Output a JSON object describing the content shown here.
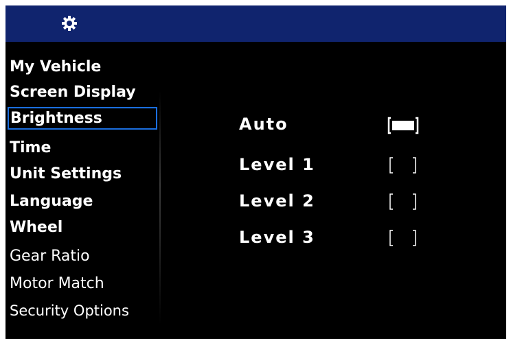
{
  "header": {
    "icon": "gear-icon"
  },
  "menu": {
    "items": [
      {
        "label": "My Vehicle"
      },
      {
        "label": "Screen Display"
      },
      {
        "label": "Brightness",
        "selected": true
      },
      {
        "label": "Time"
      },
      {
        "label": "Unit Settings"
      },
      {
        "label": "Language"
      },
      {
        "label": "Wheel"
      },
      {
        "label": "Gear Ratio"
      },
      {
        "label": "Motor Match"
      },
      {
        "label": "Security Options"
      }
    ]
  },
  "brightness_options": [
    {
      "label": "Auto",
      "checked": true
    },
    {
      "label": "Level 1",
      "checked": false
    },
    {
      "label": "Level 2",
      "checked": false
    },
    {
      "label": "Level 3",
      "checked": false
    }
  ],
  "colors": {
    "header_bg": "#10246e",
    "screen_bg": "#000000",
    "text": "#ffffff",
    "selection_border": "#1b6fe0"
  }
}
